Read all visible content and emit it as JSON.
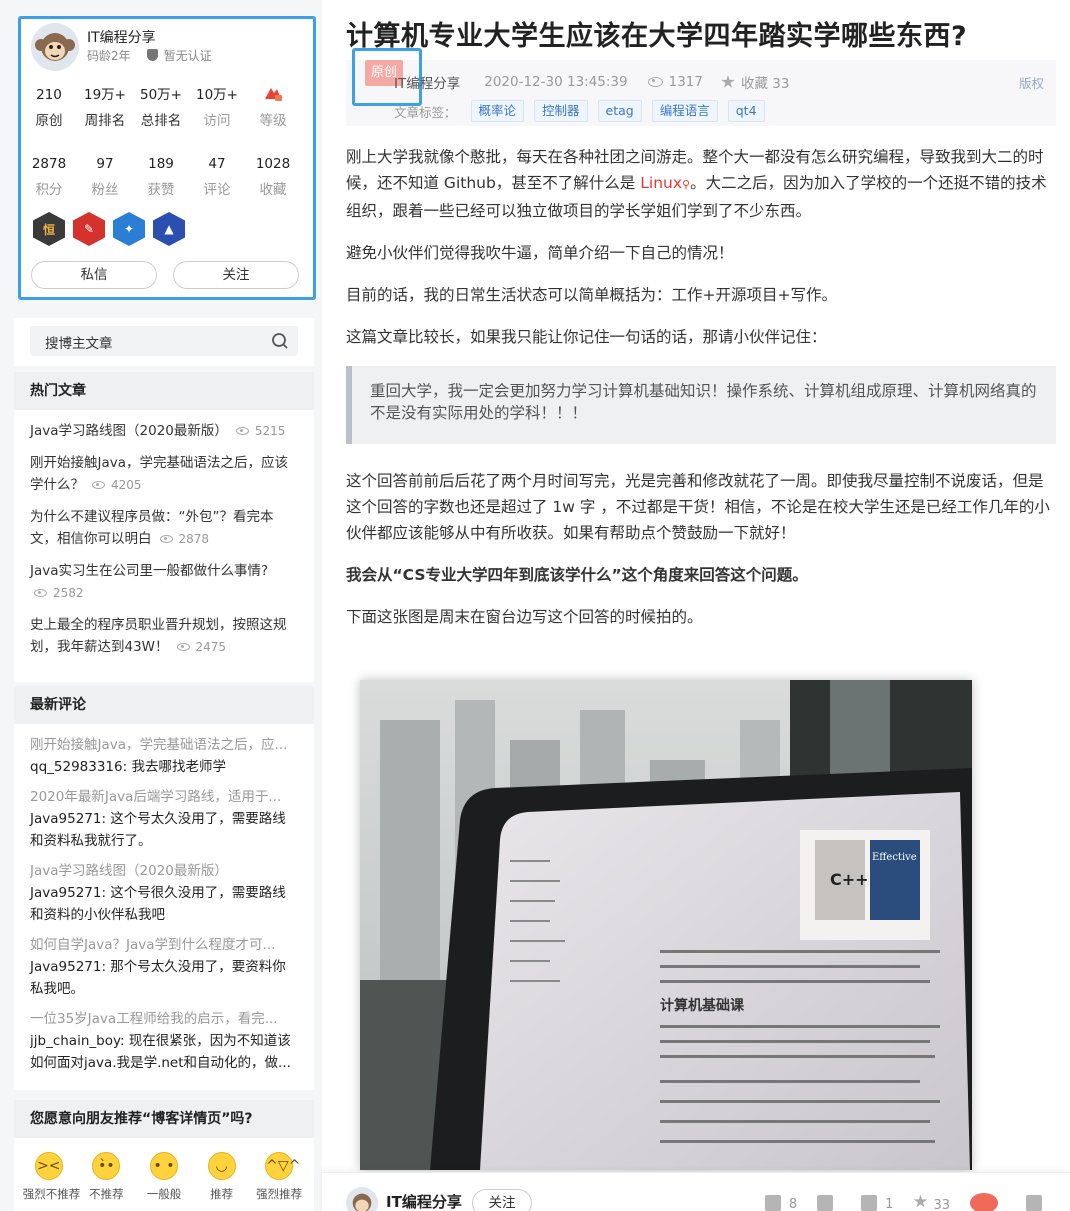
{
  "profile": {
    "name": "IT编程分享",
    "code_age": "码龄2年",
    "cert": "暂无认证",
    "stats_row1": [
      {
        "num": "210",
        "label": "原创"
      },
      {
        "num": "19万+",
        "label": "周排名"
      },
      {
        "num": "50万+",
        "label": "总排名"
      },
      {
        "num": "10万+",
        "label": "访问"
      },
      {
        "num": "",
        "label": "等级"
      }
    ],
    "stats_row2": [
      {
        "num": "2878",
        "label": "积分"
      },
      {
        "num": "97",
        "label": "粉丝"
      },
      {
        "num": "189",
        "label": "获赞"
      },
      {
        "num": "47",
        "label": "评论"
      },
      {
        "num": "1028",
        "label": "收藏"
      }
    ],
    "badge_colors": [
      "#3a3a3a",
      "#d4322c",
      "#2a7fd4",
      "#2a4fb0"
    ],
    "btn_message": "私信",
    "btn_follow": "关注"
  },
  "search": {
    "placeholder": "搜博主文章"
  },
  "hot": {
    "title": "热门文章",
    "items": [
      {
        "title": "Java学习路线图（2020最新版）",
        "views": "5215"
      },
      {
        "title": "刚开始接触Java，学完基础语法之后，应该学什么？",
        "views": "4205"
      },
      {
        "title": "为什么不建议程序员做：“外包”？看完本文，相信你可以明白",
        "views": "2878"
      },
      {
        "title": "Java实习生在公司里一般都做什么事情?",
        "views": "2582"
      },
      {
        "title": "史上最全的程序员职业晋升规划，按照这规划，我年薪达到43W！",
        "views": "2475"
      }
    ]
  },
  "comments": {
    "title": "最新评论",
    "items": [
      {
        "topic": "刚开始接触Java，学完基础语法之后，应...",
        "body": "qq_52983316: 我去哪找老师学"
      },
      {
        "topic": "2020年最新Java后端学习路线，适用于...",
        "body": "Java95271: 这个号太久没用了，需要路线和资料私我就行了。"
      },
      {
        "topic": "Java学习路线图（2020最新版）",
        "body": "Java95271: 这个号很久没用了，需要路线和资料的小伙伴私我吧"
      },
      {
        "topic": "如何自学Java？Java学到什么程度才可...",
        "body": "Java95271: 那个号太久没用了，要资料你私我吧。"
      },
      {
        "topic": "一位35岁Java工程师给我的启示，看完...",
        "body": "jjb_chain_boy: 现在很紧张，因为不知道该如何面对java.我是学.net和自动化的，做..."
      }
    ]
  },
  "recommend": {
    "title": "您愿意向朋友推荐“博客详情页”吗?",
    "options": [
      "强烈不推荐",
      "不推荐",
      "一般般",
      "推荐",
      "强烈推荐"
    ]
  },
  "article": {
    "title": "计算机专业大学生应该在大学四年踏实学哪些东西?",
    "orig_tag": "原创",
    "author": "IT编程分享",
    "date": "2020-12-30 13:45:39",
    "views": "1317",
    "fav": "收藏 33",
    "copyright": "版权",
    "tags_label": "文章标签：",
    "tags": [
      "概率论",
      "控制器",
      "etag",
      "编程语言",
      "qt4"
    ],
    "p1a": "刚上大学我就像个憨批，每天在各种社团之间游走。整个大一都没有怎么研究编程，导致我到大二的时候，还不知道 Github，甚至不了解什么是 ",
    "p1link": "Linux",
    "p1b": "。大二之后，因为加入了学校的一个还挺不错的技术组织，跟着一些已经可以独立做项目的学长学姐们学到了不少东西。",
    "p2": "避免小伙伴们觉得我吹牛逼，简单介绍一下自己的情况！",
    "p3": "目前的话，我的日常生活状态可以简单概括为：工作+开源项目+写作。",
    "p4": "这篇文章比较长，如果我只能让你记住一句话的话，那请小伙伴记住：",
    "quote": "重回大学，我一定会更加努力学习计算机基础知识！操作系统、计算机组成原理、计算机网络真的不是没有实际用处的学科！！！",
    "p5": "这个回答前前后后花了两个月时间写完，光是完善和修改就花了一周。即使我尽量控制不说废话，但是这个回答的字数也还是超过了 1w 字 ，不过都是干货！相信，不论是在校大学生还是已经工作几年的小伙伴都应该能够从中有所收获。如果有帮助点个赞鼓励一下就好！",
    "p6": "我会从“CS专业大学四年到底该学什么”这个角度来回答这个问题。",
    "p7": "下面这张图是周末在窗台边写这个回答的时候拍的。"
  },
  "footer": {
    "author": "IT编程分享",
    "follow": "关注",
    "likes": "8",
    "comments": "1",
    "favs": "33"
  }
}
